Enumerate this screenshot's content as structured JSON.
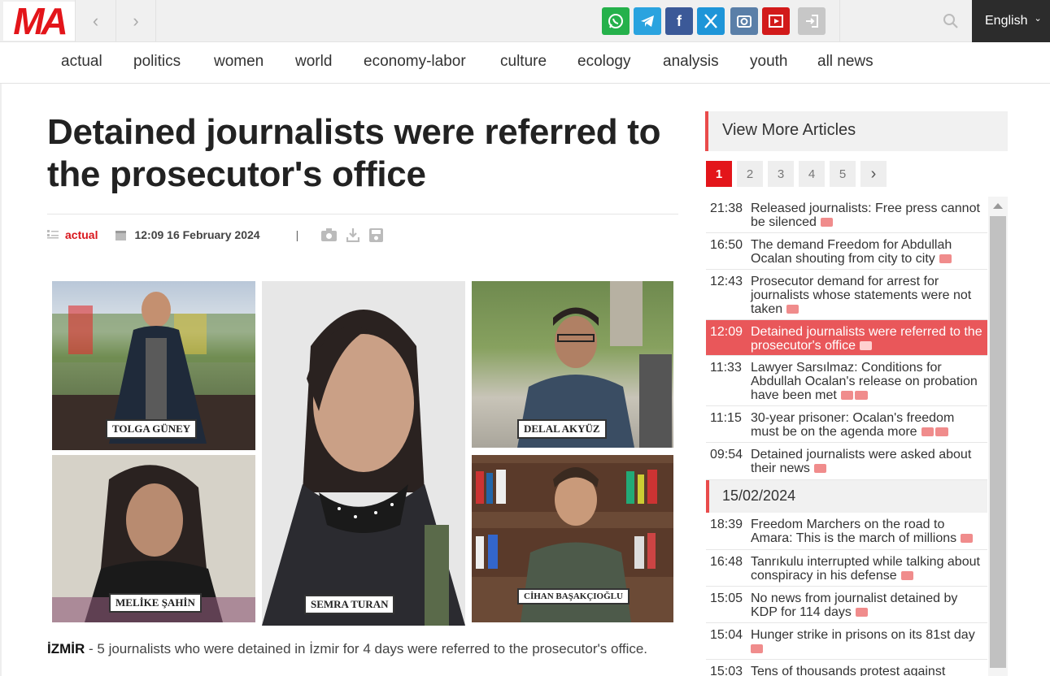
{
  "brand": {
    "logo_text": "MA",
    "color": "#e3151a"
  },
  "topbar": {
    "social_icons": [
      "whatsapp-icon",
      "telegram-icon",
      "facebook-icon",
      "x-icon",
      "instagram-icon",
      "youtube-icon",
      "login-icon"
    ],
    "social_colors": [
      "#25b14b",
      "#2aa3df",
      "#3b5998",
      "#1e95d8",
      "#5a7fa8",
      "#d21a1a",
      "#c7c7c7"
    ],
    "language": "English"
  },
  "menu": [
    "actual",
    "politics",
    "women",
    "world",
    "economy-labor",
    "culture",
    "ecology",
    "analysis",
    "youth",
    "all news"
  ],
  "article": {
    "title": "Detained journalists were referred to the prosecutor's office",
    "category": "actual",
    "date": "12:09 16 February 2024",
    "captions": [
      "TOLGA GÜNEY",
      "DELAL AKYÜZ",
      "SEMRA TURAN",
      "MELİKE ŞAHİN",
      "CİHAN BAŞAKÇIOĞLU"
    ],
    "lead_location": "İZMİR",
    "lead_text": " - 5 journalists who were detained in İzmir for 4 days were referred to the prosecutor's office."
  },
  "sidebar": {
    "heading": "View More Articles",
    "pages": [
      "1",
      "2",
      "3",
      "4",
      "5",
      "›"
    ],
    "active_page": "1",
    "news": [
      {
        "time": "21:38",
        "title": "Released journalists: Free press cannot be silenced"
      },
      {
        "time": "16:50",
        "title": "The demand Freedom for Abdullah Ocalan shouting from city to city"
      },
      {
        "time": "12:43",
        "title": "Prosecutor demand for arrest for journalists whose statements were not taken"
      },
      {
        "time": "12:09",
        "title": "Detained journalists were referred to the prosecutor's office"
      },
      {
        "time": "11:33",
        "title": "Lawyer Sarsılmaz: Conditions for Abdullah Ocalan's release on probation have been met"
      },
      {
        "time": "11:15",
        "title": "30-year prisoner: Ocalan's freedom must be on the agenda more"
      },
      {
        "time": "09:54",
        "title": "Detained journalists were asked about their news"
      }
    ],
    "date_divider": "15/02/2024",
    "news2": [
      {
        "time": "18:39",
        "title": "Freedom Marchers on the road to Amara: This is the march of millions"
      },
      {
        "time": "16:48",
        "title": "Tanrıkulu interrupted while talking about conspiracy in his defense"
      },
      {
        "time": "15:05",
        "title": "No news from journalist detained by KDP for 114 days"
      },
      {
        "time": "15:04",
        "title": "Hunger strike in prisons on its 81st day"
      },
      {
        "time": "15:03",
        "title": "Tens of thousands protest against"
      }
    ]
  }
}
